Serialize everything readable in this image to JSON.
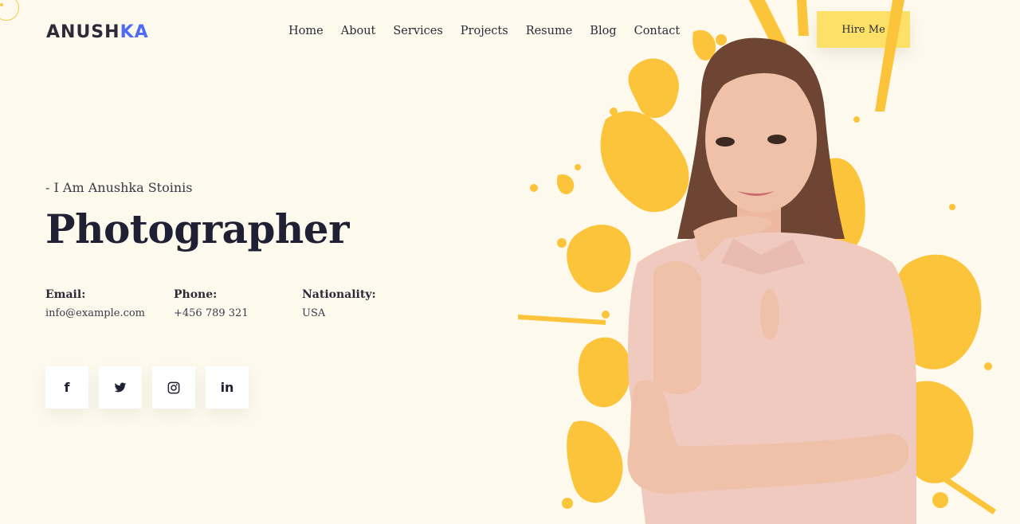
{
  "brand": {
    "prefix": "ANUSH",
    "accent": "KA"
  },
  "nav": [
    "Home",
    "About",
    "Services",
    "Projects",
    "Resume",
    "Blog",
    "Contact"
  ],
  "hire_label": "Hire Me",
  "hero": {
    "intro": "- I Am Anushka Stoinis",
    "role": "Photographer"
  },
  "info": {
    "email": {
      "label": "Email:",
      "value": "info@example.com"
    },
    "phone": {
      "label": "Phone:",
      "value": "+456 789 321"
    },
    "nationality": {
      "label": "Nationality:",
      "value": "USA"
    }
  },
  "socials": [
    {
      "icon": "facebook-icon",
      "glyph": "f"
    },
    {
      "icon": "twitter-icon",
      "glyph": ""
    },
    {
      "icon": "instagram-icon",
      "glyph": ""
    },
    {
      "icon": "linkedin-icon",
      "glyph": "in"
    }
  ],
  "colors": {
    "background": "#fdf9ec",
    "accent": "#fde068",
    "brand_accent": "#4f6bf5",
    "splash": "#fcc43a",
    "dress": "#f0c9bf"
  }
}
